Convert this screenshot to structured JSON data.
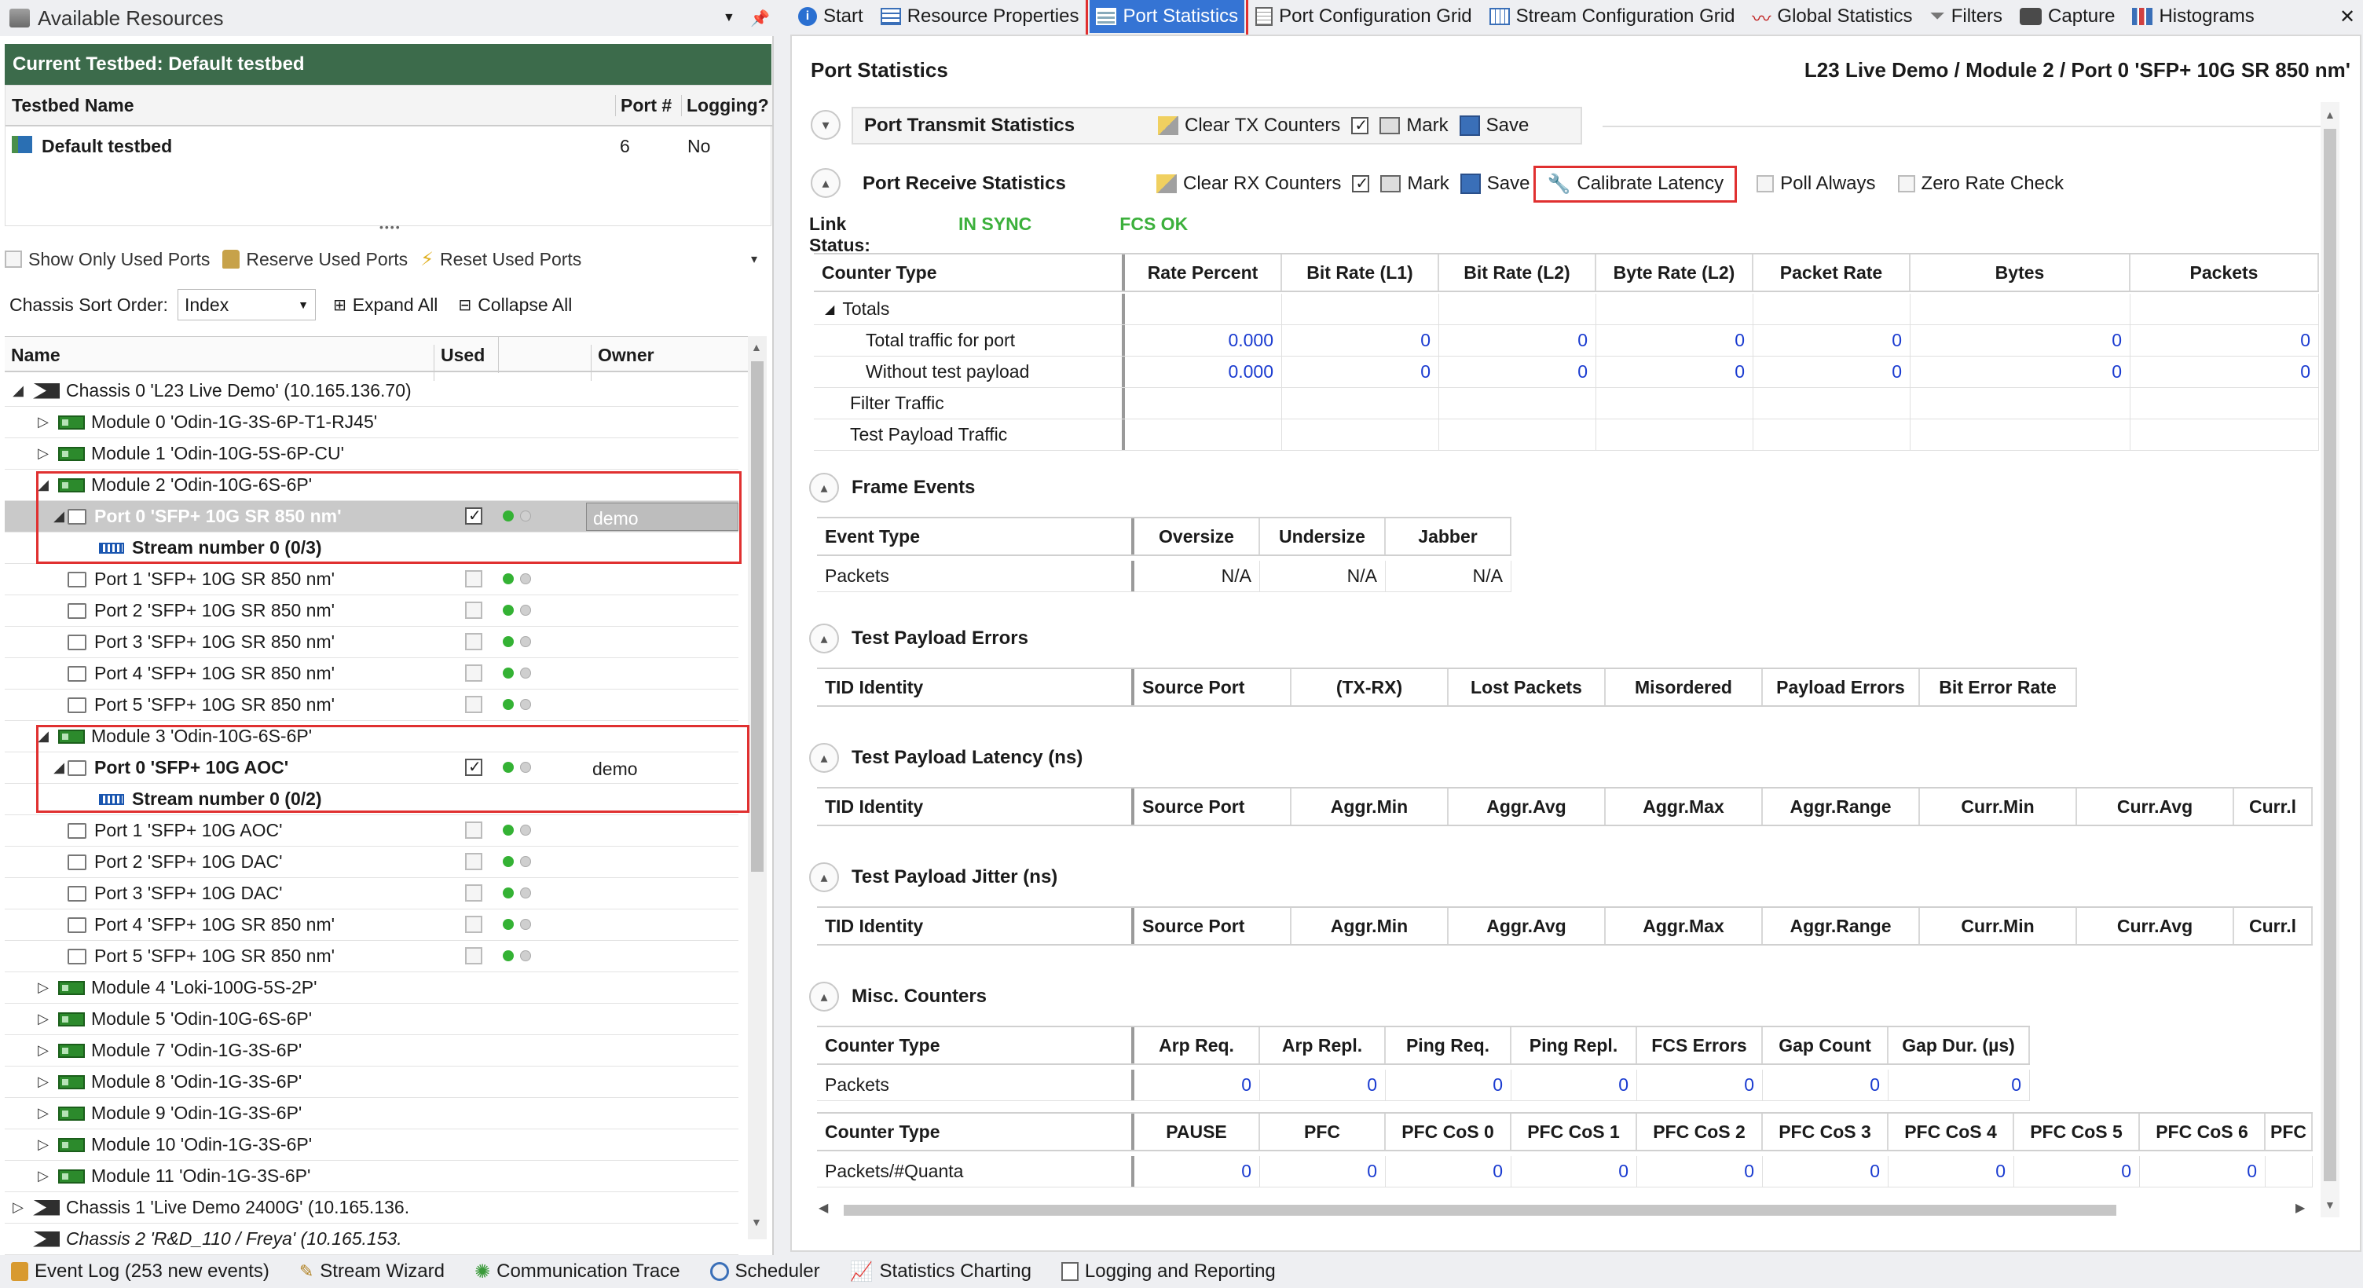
{
  "left_panel": {
    "title": "Available Resources",
    "current_testbed": "Current Testbed: Default testbed",
    "testbed_table": {
      "headers": [
        "Testbed Name",
        "Port #",
        "Logging?"
      ],
      "row": {
        "name": "Default testbed",
        "port": "6",
        "logging": "No"
      }
    },
    "toolbar": {
      "show_only_used": "Show Only Used Ports",
      "reserve_used": "Reserve Used Ports",
      "reset_used": "Reset Used Ports"
    },
    "sort": {
      "label": "Chassis Sort Order:",
      "value": "Index",
      "expand_all": "Expand All",
      "collapse_all": "Collapse All"
    },
    "tree_headers": [
      "Name",
      "Used",
      "Owner"
    ],
    "tree": [
      "Chassis 0 'L23 Live Demo' (10.165.136.70)",
      "Module 0 'Odin-1G-3S-6P-T1-RJ45'",
      "Module 1 'Odin-10G-5S-6P-CU'",
      "Module 2 'Odin-10G-6S-6P'",
      "Port 0 'SFP+ 10G SR 850 nm'",
      "Stream number 0 (0/3)",
      "Port 1 'SFP+ 10G SR 850 nm'",
      "Port 2 'SFP+ 10G SR 850 nm'",
      "Port 3 'SFP+ 10G SR 850 nm'",
      "Port 4 'SFP+ 10G SR 850 nm'",
      "Port 5 'SFP+ 10G SR 850 nm'",
      "Module 3 'Odin-10G-6S-6P'",
      "Port 0 'SFP+ 10G AOC'",
      "Stream number 0 (0/2)",
      "Port 1 'SFP+ 10G AOC'",
      "Port 2 'SFP+ 10G DAC'",
      "Port 3 'SFP+ 10G DAC'",
      "Port 4 'SFP+ 10G SR 850 nm'",
      "Port 5 'SFP+ 10G SR 850 nm'",
      "Module 4 'Loki-100G-5S-2P'",
      "Module 5 'Odin-10G-6S-6P'",
      "Module 7 'Odin-1G-3S-6P'",
      "Module 8 'Odin-1G-3S-6P'",
      "Module 9 'Odin-1G-3S-6P'",
      "Module 10 'Odin-1G-3S-6P'",
      "Module 11 'Odin-1G-3S-6P'",
      "Chassis 1 'Live Demo 2400G' (10.165.136.",
      "Chassis 2 'R&D_110 / Freya' (10.165.153."
    ],
    "owner_demo": "demo"
  },
  "tabs": [
    "Start",
    "Resource Properties",
    "Port Statistics",
    "Port Configuration Grid",
    "Stream Configuration Grid",
    "Global Statistics",
    "Filters",
    "Capture",
    "Histograms"
  ],
  "main": {
    "title": "Port Statistics",
    "context": "L23 Live Demo / Module 2 / Port 0 'SFP+ 10G SR 850 nm'",
    "tx": {
      "label": "Port Transmit Statistics",
      "clear": "Clear TX Counters",
      "mark": "Mark",
      "save": "Save"
    },
    "rx": {
      "label": "Port Receive Statistics",
      "clear": "Clear RX Counters",
      "mark": "Mark",
      "save": "Save",
      "calibrate": "Calibrate Latency",
      "poll": "Poll Always",
      "zero": "Zero Rate Check"
    },
    "link_status": {
      "label": "Link Status:",
      "sync": "IN SYNC",
      "fcs": "FCS OK"
    },
    "counters": {
      "headers": [
        "Counter Type",
        "Rate Percent",
        "Bit Rate (L1)",
        "Bit Rate (L2)",
        "Byte Rate (L2)",
        "Packet Rate",
        "Bytes",
        "Packets"
      ],
      "totals": "Totals",
      "rows": [
        {
          "name": "Total traffic for port",
          "values": [
            "0.000",
            "0",
            "0",
            "0",
            "0",
            "0",
            "0"
          ]
        },
        {
          "name": "Without test payload",
          "values": [
            "0.000",
            "0",
            "0",
            "0",
            "0",
            "0",
            "0"
          ]
        },
        {
          "name": "Filter Traffic",
          "values": []
        },
        {
          "name": "Test Payload Traffic",
          "values": []
        }
      ]
    },
    "frame_events": {
      "title": "Frame Events",
      "headers": [
        "Event Type",
        "Oversize",
        "Undersize",
        "Jabber"
      ],
      "row": [
        "Packets",
        "N/A",
        "N/A",
        "N/A"
      ]
    },
    "payload_errors": {
      "title": "Test Payload Errors",
      "headers": [
        "TID Identity",
        "Source Port",
        "(TX-RX)",
        "Lost Packets",
        "Misordered",
        "Payload Errors",
        "Bit Error Rate"
      ]
    },
    "latency": {
      "title": "Test Payload Latency (ns)",
      "headers": [
        "TID Identity",
        "Source Port",
        "Aggr.Min",
        "Aggr.Avg",
        "Aggr.Max",
        "Aggr.Range",
        "Curr.Min",
        "Curr.Avg",
        "Curr.l"
      ]
    },
    "jitter": {
      "title": "Test Payload Jitter (ns)",
      "headers": [
        "TID Identity",
        "Source Port",
        "Aggr.Min",
        "Aggr.Avg",
        "Aggr.Max",
        "Aggr.Range",
        "Curr.Min",
        "Curr.Avg",
        "Curr.l"
      ]
    },
    "misc": {
      "title": "Misc. Counters",
      "headers1": [
        "Counter Type",
        "Arp Req.",
        "Arp Repl.",
        "Ping Req.",
        "Ping Repl.",
        "FCS Errors",
        "Gap Count",
        "Gap Dur. (µs)"
      ],
      "row1": [
        "Packets",
        "0",
        "0",
        "0",
        "0",
        "0",
        "0",
        "0"
      ],
      "headers2": [
        "Counter Type",
        "PAUSE",
        "PFC",
        "PFC CoS 0",
        "PFC CoS 1",
        "PFC CoS 2",
        "PFC CoS 3",
        "PFC CoS 4",
        "PFC CoS 5",
        "PFC CoS 6",
        "PFC"
      ],
      "row2": [
        "Packets/#Quanta",
        "0",
        "0",
        "0",
        "0",
        "0",
        "0",
        "0",
        "0",
        "0",
        ""
      ]
    }
  },
  "bottom_tabs": [
    "Event Log (253 new events)",
    "Stream Wizard",
    "Communication Trace",
    "Scheduler",
    "Statistics Charting",
    "Logging and Reporting"
  ]
}
